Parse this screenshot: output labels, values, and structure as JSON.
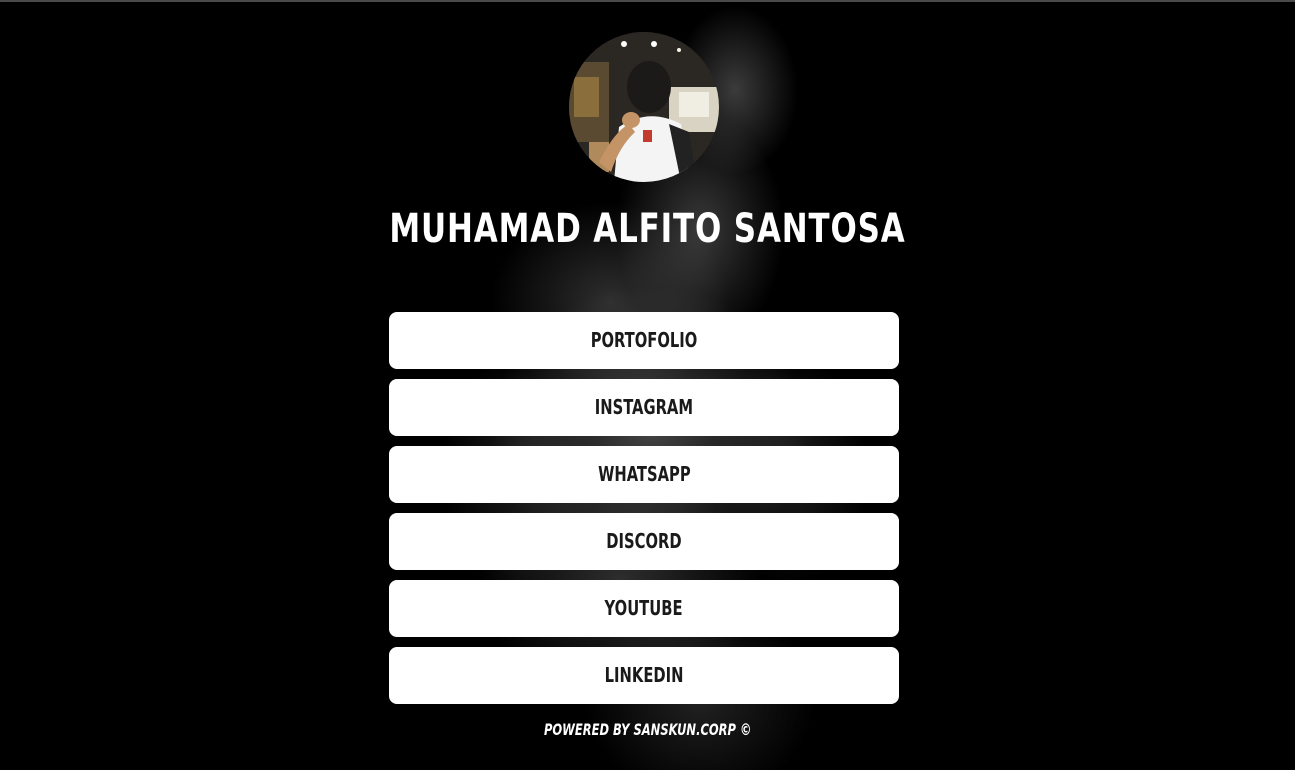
{
  "profile": {
    "name": "MUHAMAD ALFITO SANTOSA",
    "avatar_icon": "profile-photo"
  },
  "links": [
    {
      "label": "PORTOFOLIO"
    },
    {
      "label": "INSTAGRAM"
    },
    {
      "label": "WHATSAPP"
    },
    {
      "label": "DISCORD"
    },
    {
      "label": "YOUTUBE"
    },
    {
      "label": "LINKEDIN"
    }
  ],
  "footer": {
    "text": "POWERED BY SANSKUN.CORP ©"
  },
  "colors": {
    "background": "#000000",
    "button": "#ffffff",
    "button_text": "#1a1a1a",
    "text": "#ffffff"
  }
}
